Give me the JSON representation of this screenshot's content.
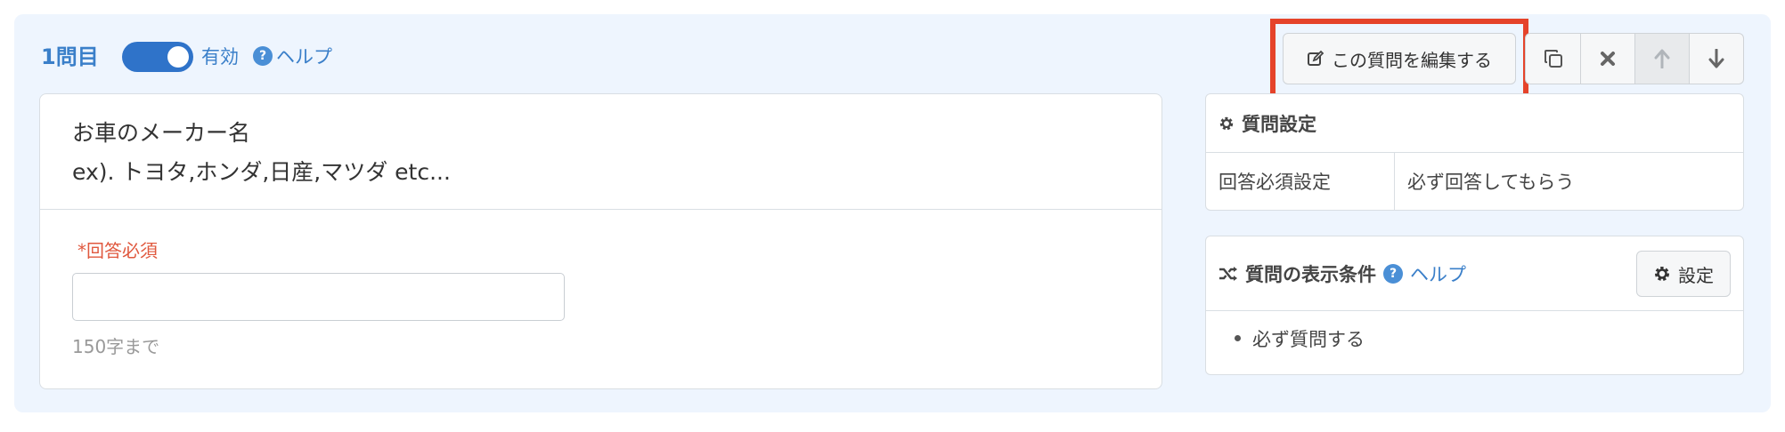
{
  "header": {
    "question_number": "1問目",
    "toggle_label": "有効",
    "help_label": "ヘルプ",
    "toggle_on": true
  },
  "toolbar": {
    "edit_label": "この質問を編集する",
    "copy_icon": "copy-icon",
    "delete_icon": "close-icon",
    "up_icon": "arrow-up-icon",
    "down_icon": "arrow-down-icon",
    "highlight_color": "#e5432a"
  },
  "question": {
    "line1": "お車のメーカー名",
    "line2": "ex). トヨタ,ホンダ,日産,マツダ etc...",
    "required_label": "*回答必須",
    "input_value": "",
    "limit_text": "150字まで"
  },
  "settings": {
    "title": "質問設定",
    "rows": [
      {
        "key": "回答必須設定",
        "value": "必ず回答してもらう"
      }
    ]
  },
  "conditions": {
    "title": "質問の表示条件",
    "help_label": "ヘルプ",
    "set_button_label": "設定",
    "items": [
      "必ず質問する"
    ]
  },
  "colors": {
    "accent": "#2f73c9",
    "panel_bg": "#eef5fe",
    "required": "#e0583e"
  }
}
